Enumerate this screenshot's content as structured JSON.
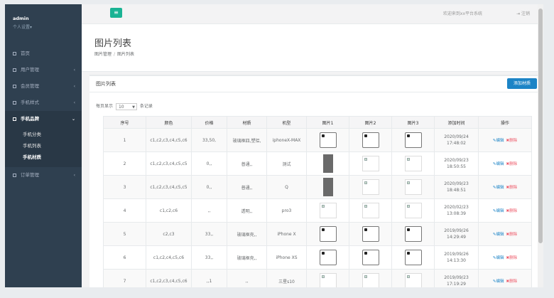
{
  "sidebar": {
    "username": "admin",
    "settings": "个人设置▾",
    "items": [
      {
        "label": "首页",
        "arrow": ""
      },
      {
        "label": "用户管理",
        "arrow": "‹"
      },
      {
        "label": "会员管理",
        "arrow": "‹"
      },
      {
        "label": "手机样式",
        "arrow": "‹"
      },
      {
        "label": "手机品牌",
        "arrow": "⌄"
      },
      {
        "label": "订单管理",
        "arrow": "‹"
      }
    ],
    "sub_items": [
      "手机分类",
      "手机列表",
      "手机材质"
    ]
  },
  "topbar": {
    "menu_icon": "≡",
    "welcome": "欢迎来到xx平台系统",
    "logout": "⇥ 注销"
  },
  "page": {
    "title": "图片列表",
    "breadcrumb": [
      "图片管理",
      "图片列表"
    ]
  },
  "panel": {
    "title": "图片列表",
    "add_button": "添加材质",
    "length_prefix": "每页显示",
    "length_value": "10",
    "length_suffix": "条记录"
  },
  "table": {
    "headers": [
      "序号",
      "颜色",
      "价格",
      "材质",
      "机型",
      "图片1",
      "图片2",
      "图片3",
      "添加时间",
      "操作"
    ],
    "edit_label": "✎编辑",
    "delete_label": "✖删除",
    "rows": [
      {
        "id": "1",
        "color": "c1,c2,c3,c4,c5,c6",
        "price": "33,50,",
        "material": "玻璃框四,塑铝,",
        "model": "iphoneX-MAX",
        "date": "2020/09/24",
        "time": "17:48:02",
        "imgs": [
          "ph",
          "ph",
          "ph"
        ]
      },
      {
        "id": "2",
        "color": "c1,c2,c3,c4,c5,c5",
        "price": "0,,",
        "material": "普通,,",
        "model": "测试",
        "date": "2020/09/23",
        "time": "18:50:55",
        "imgs": [
          "dark",
          "broken",
          "broken"
        ]
      },
      {
        "id": "3",
        "color": "c1,c2,c3,c4,c5,c5",
        "price": "0,,",
        "material": "普通,,",
        "model": "Q",
        "date": "2020/09/23",
        "time": "18:48:51",
        "imgs": [
          "dark",
          "broken",
          "broken"
        ]
      },
      {
        "id": "4",
        "color": "c1,c2,c6",
        "price": ",,",
        "material": "透明,,",
        "model": "pro3",
        "date": "2020/02/23",
        "time": "13:08:39",
        "imgs": [
          "broken",
          "broken",
          "broken"
        ]
      },
      {
        "id": "5",
        "color": "c2,c3",
        "price": "33,,",
        "material": "玻璃框壳,,",
        "model": "iPhone X",
        "date": "2019/09/26",
        "time": "14:29:49",
        "imgs": [
          "ph",
          "ph",
          "ph"
        ]
      },
      {
        "id": "6",
        "color": "c1,c2,c4,c5,c6",
        "price": "33,,",
        "material": "玻璃框壳,,",
        "model": "iPhone XS",
        "date": "2019/09/26",
        "time": "14:13:30",
        "imgs": [
          "ph",
          "ph",
          "ph"
        ]
      },
      {
        "id": "7",
        "color": "c1,c2,c3,c4,c5,c6",
        "price": ",,1",
        "material": ",,",
        "model": "三星s10",
        "date": "2019/09/23",
        "time": "17:19:29",
        "imgs": [
          "broken",
          "broken",
          "broken"
        ]
      }
    ]
  },
  "colors": {
    "sidebar_bg": "#2f4050",
    "accent_green": "#1ab394",
    "primary_blue": "#1c84c6",
    "danger_red": "#ed5565"
  }
}
